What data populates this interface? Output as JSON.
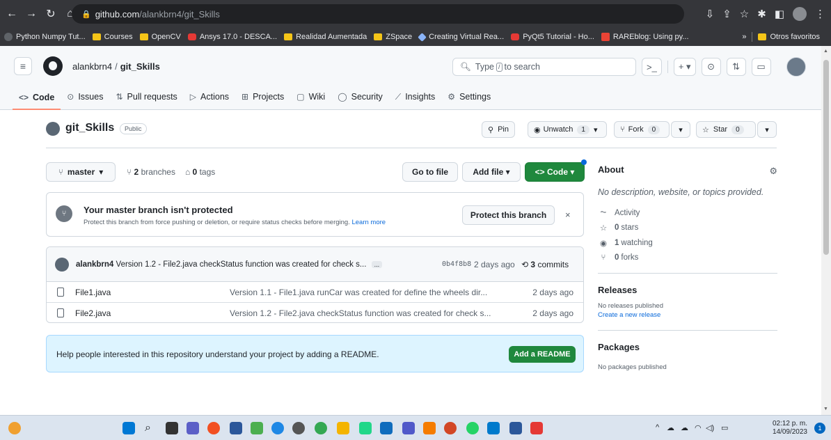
{
  "browser": {
    "url_host": "github.com",
    "url_path": "/alankbrn4/git_Skills",
    "bookmarks": [
      {
        "label": "Python Numpy Tut...",
        "icon": "globe-icon"
      },
      {
        "label": "Courses",
        "icon": "folder-icon"
      },
      {
        "label": "OpenCV",
        "icon": "folder-icon"
      },
      {
        "label": "Ansys 17.0 - DESCA...",
        "icon": "youtube-icon"
      },
      {
        "label": "Realidad Aumentada",
        "icon": "folder-icon"
      },
      {
        "label": "ZSpace",
        "icon": "folder-icon"
      },
      {
        "label": "Creating Virtual Rea...",
        "icon": "gem-icon"
      },
      {
        "label": "PyQt5 Tutorial - Ho...",
        "icon": "youtube-icon"
      },
      {
        "label": "RAREblog: Using py...",
        "icon": "blogger-icon"
      }
    ],
    "more_bookmarks": "»",
    "other_favorites": "Otros favoritos"
  },
  "header": {
    "owner": "alankbrn4",
    "slash": "/",
    "repo": "git_Skills",
    "search_prefix": "Type",
    "search_key": "/",
    "search_suffix": "to search",
    "plus": "+ ▾"
  },
  "tabs": [
    {
      "label": "Code",
      "icon": "<>"
    },
    {
      "label": "Issues",
      "icon": "⊙"
    },
    {
      "label": "Pull requests",
      "icon": "⇅"
    },
    {
      "label": "Actions",
      "icon": "▷"
    },
    {
      "label": "Projects",
      "icon": "⊞"
    },
    {
      "label": "Wiki",
      "icon": "▢"
    },
    {
      "label": "Security",
      "icon": "◯"
    },
    {
      "label": "Insights",
      "icon": "⟋"
    },
    {
      "label": "Settings",
      "icon": "⚙"
    }
  ],
  "repo": {
    "name": "git_Skills",
    "visibility": "Public",
    "pin_label": "Pin",
    "unwatch_label": "Unwatch",
    "unwatch_count": "1",
    "fork_label": "Fork",
    "fork_count": "0",
    "star_label": "Star",
    "star_count": "0"
  },
  "toolbar": {
    "branch": "master",
    "branches_count": "2",
    "branches_label": "branches",
    "tags_count": "0",
    "tags_label": "tags",
    "go_to_file": "Go to file",
    "add_file": "Add file ▾",
    "code": "<> Code ▾"
  },
  "protect": {
    "title": "Your master branch isn't protected",
    "text": "Protect this branch from force pushing or deletion, or require status checks before merging.",
    "link": "Learn more",
    "button": "Protect this branch",
    "close": "×"
  },
  "commit": {
    "author": "alankbrn4",
    "message": "Version 1.2 - File2.java checkStatus function was created for check s...",
    "ellipsis": "...",
    "sha": "0b4f8b8",
    "ago": "2 days ago",
    "commits_count": "3",
    "commits_label": "commits"
  },
  "files": [
    {
      "name": "File1.java",
      "message": "Version 1.1 - File1.java runCar was created for define the wheels dir...",
      "date": "2 days ago"
    },
    {
      "name": "File2.java",
      "message": "Version 1.2 - File2.java checkStatus function was created for check s...",
      "date": "2 days ago"
    }
  ],
  "readme": {
    "text": "Help people interested in this repository understand your project by adding a README.",
    "button": "Add a README"
  },
  "sidebar": {
    "about_title": "About",
    "description": "No description, website, or topics provided.",
    "activity": "Activity",
    "stars_count": "0",
    "stars_label": "stars",
    "watching_count": "1",
    "watching_label": "watching",
    "forks_count": "0",
    "forks_label": "forks",
    "releases_title": "Releases",
    "no_releases": "No releases published",
    "create_release": "Create a new release",
    "packages_title": "Packages",
    "no_packages": "No packages published"
  },
  "taskbar": {
    "time": "02:12 p. m.",
    "date": "14/09/2023",
    "notifications": "1"
  },
  "colors": {
    "accent_green": "#1f883d",
    "link_blue": "#0969da",
    "tab_underline": "#fd8c73"
  }
}
